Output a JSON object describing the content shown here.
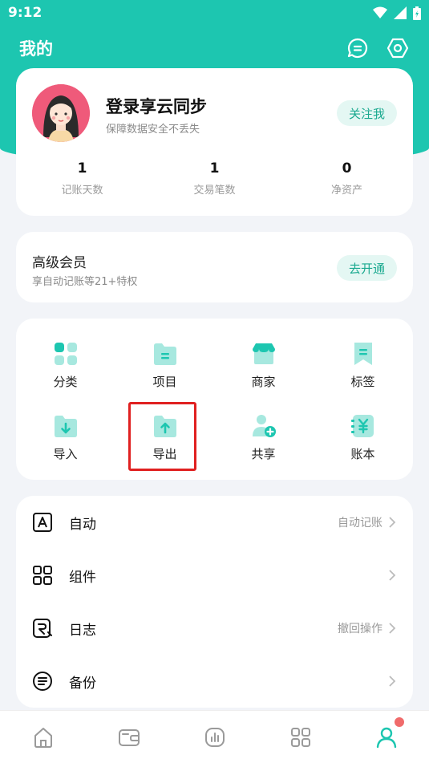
{
  "status": {
    "time": "9:12"
  },
  "header": {
    "title": "我的"
  },
  "profile": {
    "name": "登录享云同步",
    "subtitle": "保障数据安全不丢失",
    "follow_label": "关注我",
    "stats": [
      {
        "value": "1",
        "label": "记账天数"
      },
      {
        "value": "1",
        "label": "交易笔数"
      },
      {
        "value": "0",
        "label": "净资产"
      }
    ]
  },
  "vip": {
    "title": "高级会员",
    "subtitle": "享自动记账等21+特权",
    "button_label": "去开通"
  },
  "grid": {
    "items": [
      {
        "label": "分类",
        "icon": "category-icon"
      },
      {
        "label": "项目",
        "icon": "project-folder-icon"
      },
      {
        "label": "商家",
        "icon": "store-icon"
      },
      {
        "label": "标签",
        "icon": "tag-bookmark-icon"
      },
      {
        "label": "导入",
        "icon": "import-folder-icon"
      },
      {
        "label": "导出",
        "icon": "export-folder-icon"
      },
      {
        "label": "共享",
        "icon": "share-user-icon"
      },
      {
        "label": "账本",
        "icon": "ledger-icon"
      }
    ]
  },
  "list": {
    "rows": [
      {
        "label": "自动",
        "hint": "自动记账",
        "icon": "auto-icon"
      },
      {
        "label": "组件",
        "hint": "",
        "icon": "widgets-icon"
      },
      {
        "label": "日志",
        "hint": "撤回操作",
        "icon": "log-icon"
      },
      {
        "label": "备份",
        "hint": "",
        "icon": "backup-icon"
      }
    ]
  },
  "tabbar": {
    "tabs": [
      {
        "icon": "home-icon"
      },
      {
        "icon": "wallet-icon"
      },
      {
        "icon": "stats-icon"
      },
      {
        "icon": "apps-icon"
      },
      {
        "icon": "profile-icon",
        "active": true
      }
    ]
  },
  "colors": {
    "accent": "#1dc6b0",
    "accent_light": "#a7e8df",
    "text_dark": "#111111",
    "highlight_red": "#e02020"
  }
}
